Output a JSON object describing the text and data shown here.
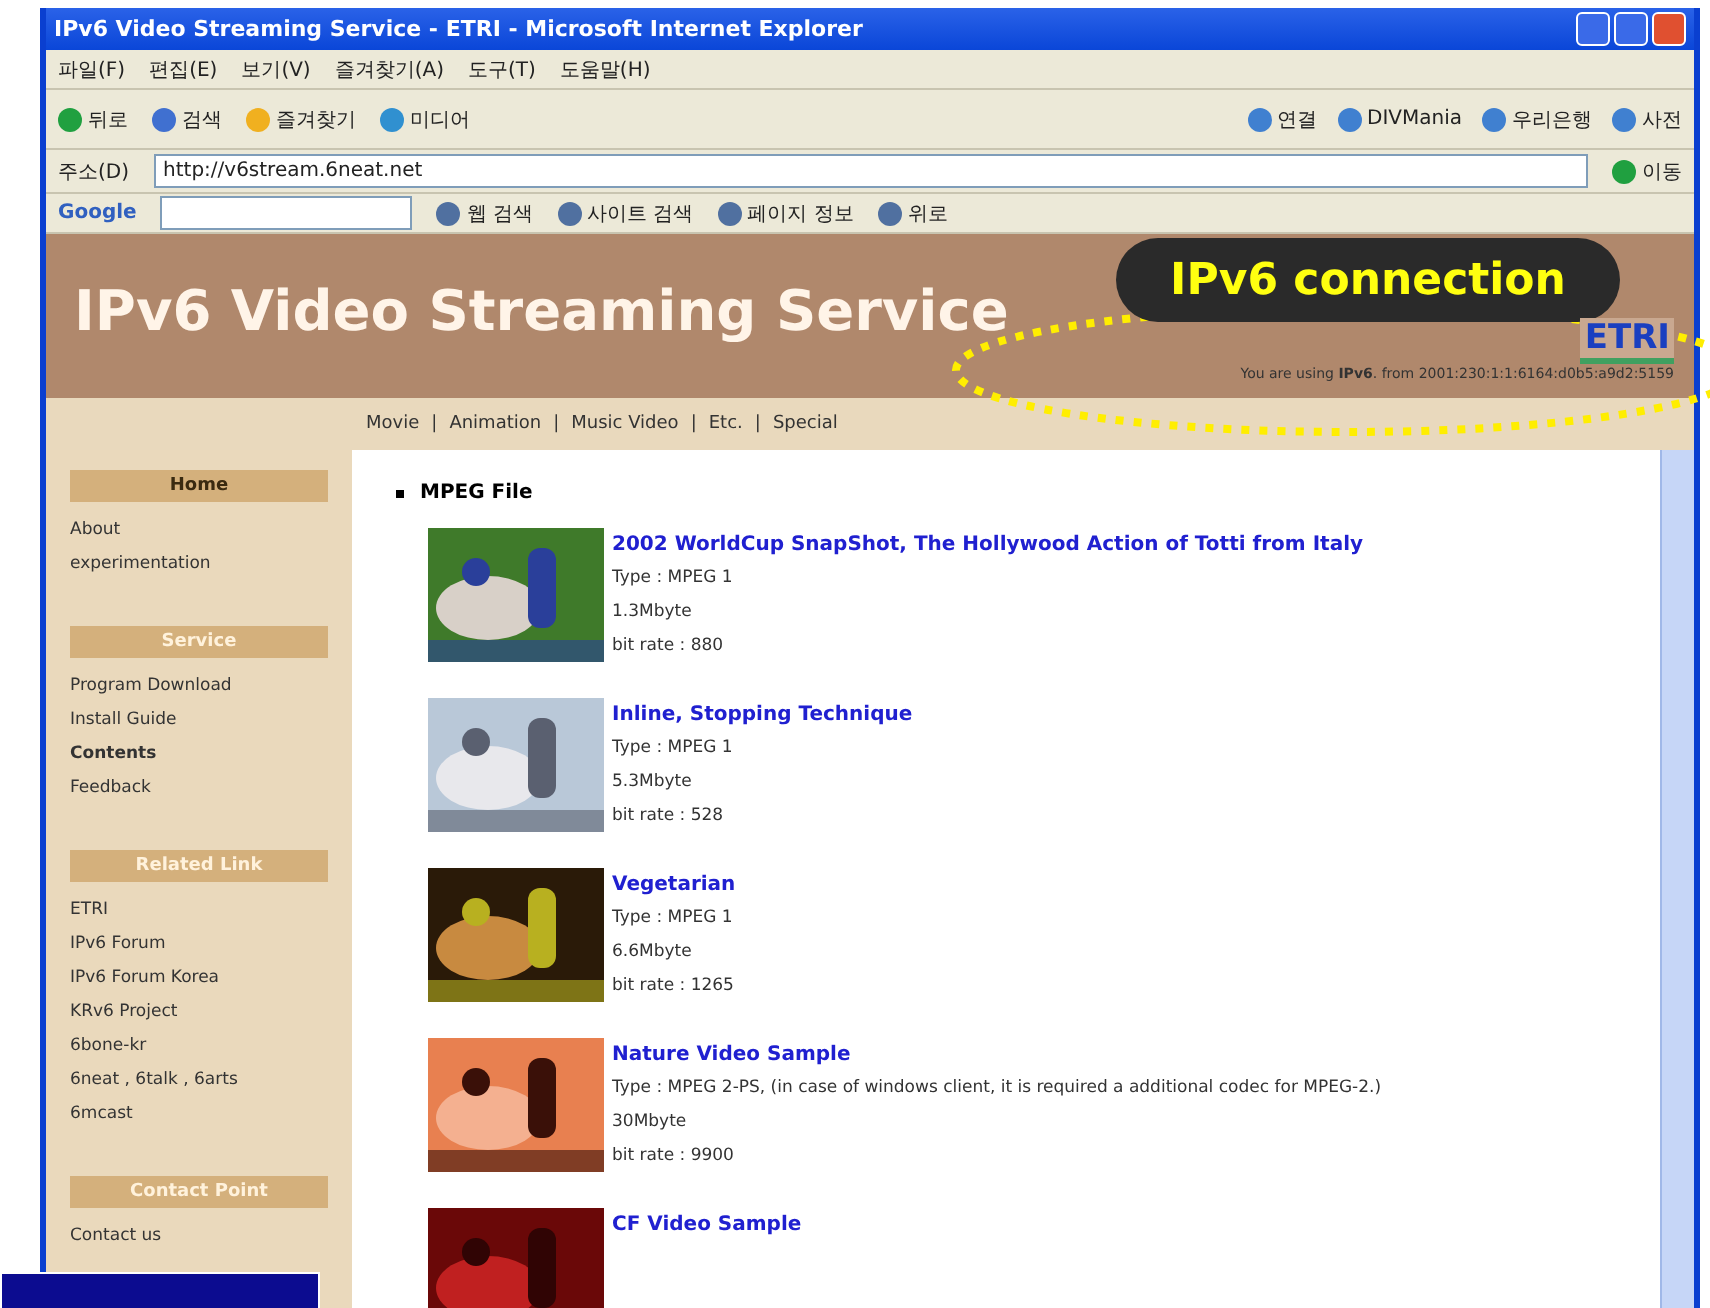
{
  "window": {
    "title": "IPv6 Video Streaming Service - ETRI - Microsoft Internet Explorer"
  },
  "menu": [
    "파일(F)",
    "편집(E)",
    "보기(V)",
    "즐겨찾기(A)",
    "도구(T)",
    "도움말(H)"
  ],
  "toolbar": [
    "뒤로",
    "검색",
    "즐겨찾기",
    "미디어"
  ],
  "links": [
    "연결",
    "DIVMania",
    "우리은행",
    "사전"
  ],
  "address": {
    "label": "주소(D)",
    "value": "http://v6stream.6neat.net",
    "go": "이동"
  },
  "google": {
    "logo": "Google",
    "buttons": [
      "웹 검색",
      "사이트 검색",
      "페이지 정보",
      "위로"
    ]
  },
  "header": {
    "title": "IPv6 Video Streaming Service",
    "logo": "ETRI",
    "notice": "You are using **IPv6**. from 2001:230:1:1:6164:d0b5:a9d2:5159"
  },
  "nav": {
    "separator": "|",
    "items": [
      "Movie",
      "Animation",
      "Music Video",
      "Etc.",
      "Special"
    ]
  },
  "sidebar": [
    {
      "heading": "Home",
      "active": true,
      "items": [
        {
          "label": "About",
          "selected": false
        },
        {
          "label": "experimentation",
          "selected": false
        }
      ]
    },
    {
      "heading": "Service",
      "active": false,
      "items": [
        {
          "label": "Program Download",
          "selected": false
        },
        {
          "label": "Install Guide",
          "selected": false
        },
        {
          "label": "Contents",
          "selected": true
        },
        {
          "label": "Feedback",
          "selected": false
        }
      ]
    },
    {
      "heading": "Related Link",
      "active": false,
      "items": [
        {
          "label": "ETRI",
          "selected": false
        },
        {
          "label": "IPv6 Forum",
          "selected": false
        },
        {
          "label": "IPv6 Forum Korea",
          "selected": false
        },
        {
          "label": "KRv6 Project",
          "selected": false
        },
        {
          "label": "6bone-kr",
          "selected": false
        },
        {
          "label": "6neat , 6talk , 6arts",
          "selected": false
        },
        {
          "label": "6mcast",
          "selected": false
        }
      ]
    },
    {
      "heading": "Contact Point",
      "active": false,
      "items": [
        {
          "label": "Contact us",
          "selected": false
        }
      ]
    }
  ],
  "section": "MPEG File",
  "videos": [
    {
      "title": "2002 WorldCup SnapShot, The Hollywood Action of Totti from Italy",
      "lines": [
        "Type : MPEG 1",
        "1.3Mbyte",
        "bit rate : 880"
      ]
    },
    {
      "title": "Inline, Stopping Technique",
      "lines": [
        "Type : MPEG 1",
        "5.3Mbyte",
        "bit rate : 528"
      ]
    },
    {
      "title": "Vegetarian",
      "lines": [
        "Type : MPEG 1",
        "6.6Mbyte",
        "bit rate : 1265"
      ]
    },
    {
      "title": "Nature Video Sample",
      "lines": [
        "Type : MPEG 2-PS, (in case of windows client, it is required a additional codec for MPEG-2.)",
        "30Mbyte",
        "bit rate : 9900"
      ]
    },
    {
      "title": "CF Video Sample"
    }
  ],
  "annotation": {
    "label": "IPv6 connection"
  }
}
